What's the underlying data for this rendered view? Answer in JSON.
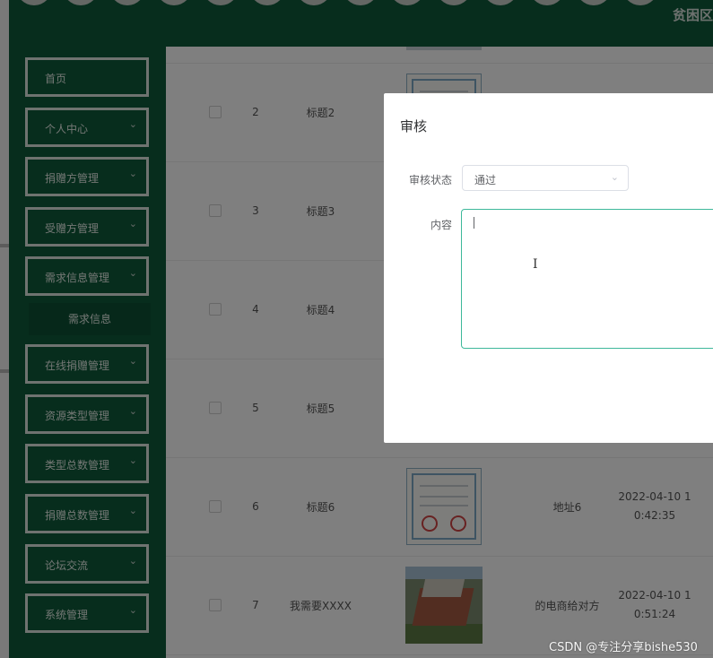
{
  "header": {
    "brand_text": "贫困区"
  },
  "sidebar": {
    "items": [
      {
        "label": "首页",
        "has_chevron": false
      },
      {
        "label": "个人中心",
        "has_chevron": true
      },
      {
        "label": "捐赠方管理",
        "has_chevron": true
      },
      {
        "label": "受赠方管理",
        "has_chevron": true
      },
      {
        "label": "需求信息管理",
        "has_chevron": true
      },
      {
        "label": "在线捐赠管理",
        "has_chevron": true
      },
      {
        "label": "资源类型管理",
        "has_chevron": true
      },
      {
        "label": "类型总数管理",
        "has_chevron": true
      },
      {
        "label": "捐赠总数管理",
        "has_chevron": true
      },
      {
        "label": "论坛交流",
        "has_chevron": true
      },
      {
        "label": "系统管理",
        "has_chevron": true
      }
    ],
    "submenu": {
      "label": "需求信息"
    },
    "chevron_icon": "chevron-down-icon"
  },
  "table": {
    "rows": [
      {
        "index": "2",
        "title": "标题2",
        "image": "certificate",
        "address": "",
        "time_line1": "",
        "time_line2": ""
      },
      {
        "index": "3",
        "title": "标题3",
        "image": "",
        "address": "",
        "time_line1": "",
        "time_line2": ""
      },
      {
        "index": "4",
        "title": "标题4",
        "image": "",
        "address": "",
        "time_line1": "",
        "time_line2": ""
      },
      {
        "index": "5",
        "title": "标题5",
        "image": "",
        "address": "",
        "time_line1": "",
        "time_line2": ""
      },
      {
        "index": "6",
        "title": "标题6",
        "image": "certificate",
        "address": "地址6",
        "time_line1": "2022-04-10 1",
        "time_line2": "0:42:35"
      },
      {
        "index": "7",
        "title": "我需要XXXX",
        "image": "building-photo",
        "address": "的电商给对方",
        "time_line1": "2022-04-10 1",
        "time_line2": "0:51:24"
      }
    ]
  },
  "dialog": {
    "title": "审核",
    "status_label": "审核状态",
    "status_value": "通过",
    "content_label": "内容",
    "content_value": ""
  },
  "watermark": "CSDN @专注分享bishe530",
  "colors": {
    "sidebar_bg": "#0f5a3b",
    "header_bg": "#0f5a3b",
    "textarea_focus_border": "#3db89a",
    "overlay": "rgba(0,0,0,0.5)"
  }
}
